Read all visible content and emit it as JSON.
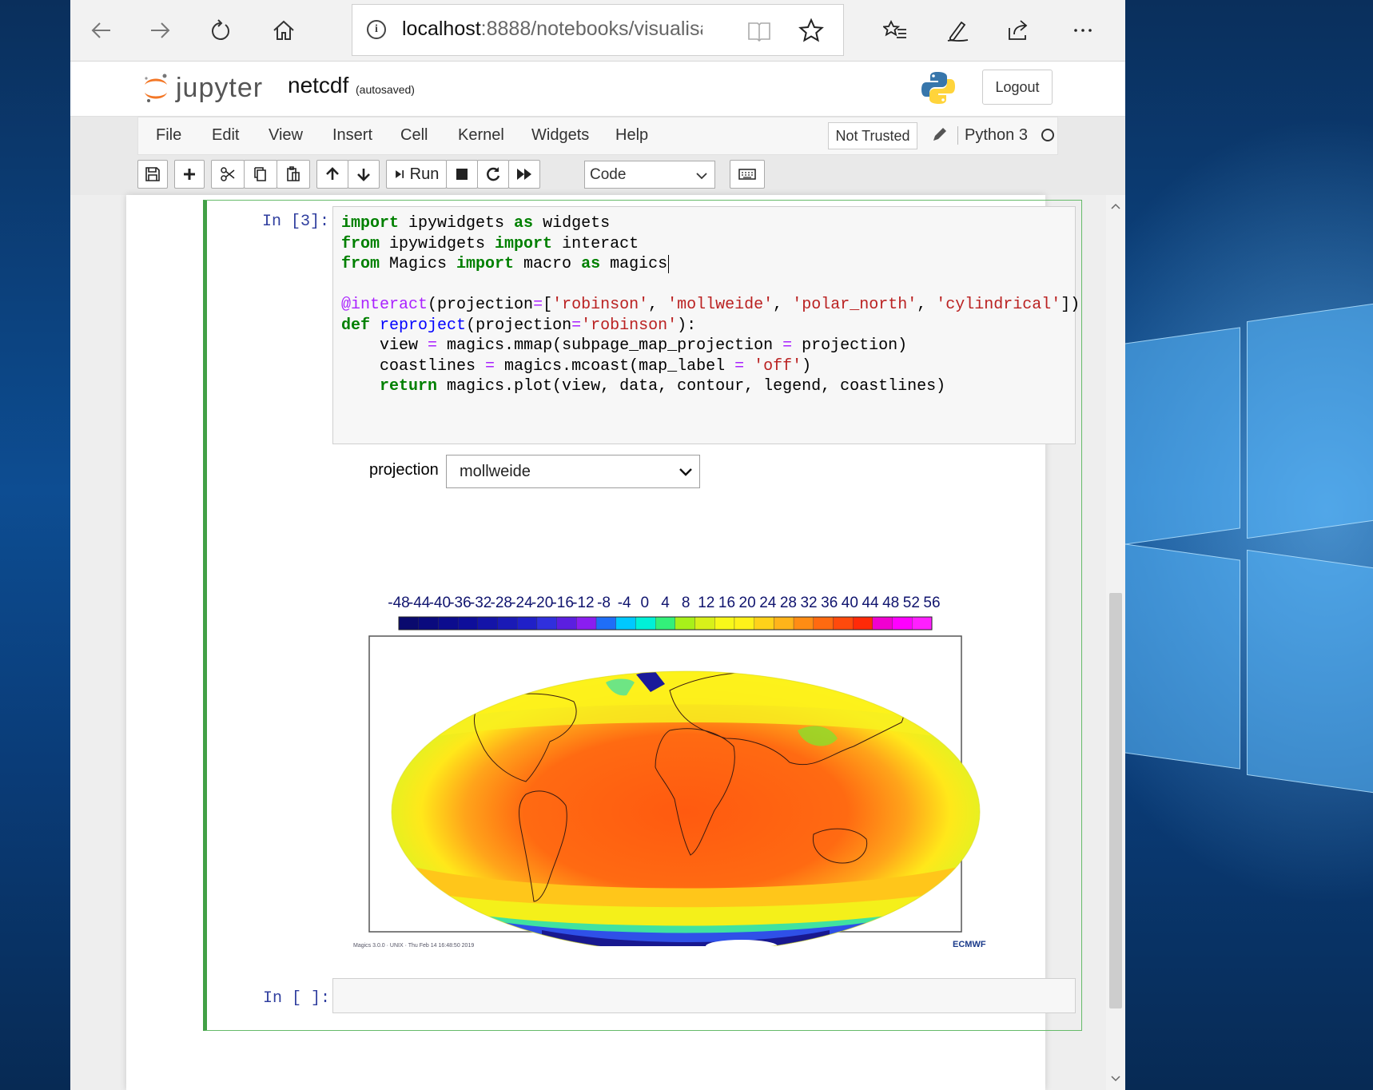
{
  "browser": {
    "url_host": "localhost",
    "url_path": ":8888/notebooks/visualisa"
  },
  "jupyter": {
    "brand": "jupyter",
    "notebook_name": "netcdf",
    "save_status": "(autosaved)",
    "logout_label": "Logout",
    "trust_label": "Not Trusted",
    "kernel_name": "Python 3"
  },
  "menu": {
    "items": [
      "File",
      "Edit",
      "View",
      "Insert",
      "Cell",
      "Kernel",
      "Widgets",
      "Help"
    ]
  },
  "toolbar": {
    "run_label": "Run",
    "cell_type": "Code"
  },
  "cell": {
    "prompt": "In [3]:",
    "code_lines": [
      "import ipywidgets as widgets",
      "from ipywidgets import interact",
      "from Magics import macro as magics",
      "",
      "@interact(projection=['robinson', 'mollweide', 'polar_north', 'cylindrical'])",
      "def reproject(projection='robinson'):",
      "    view = magics.mmap(subpage_map_projection = projection)",
      "    coastlines = magics.mcoast(map_label = 'off')",
      "    return magics.plot(view, data, contour, legend, coastlines)"
    ],
    "widget_label": "projection",
    "widget_value": "mollweide"
  },
  "plot": {
    "colorbar_labels": [
      "-48",
      "-44",
      "-40",
      "-36",
      "-32",
      "-28",
      "-24",
      "-20",
      "-16",
      "-12",
      "-8",
      "-4",
      "0",
      "4",
      "8",
      "12",
      "16",
      "20",
      "24",
      "28",
      "32",
      "36",
      "40",
      "44",
      "48",
      "52",
      "56"
    ],
    "colorbar_colors": [
      "#0a0a6e",
      "#0a0a7e",
      "#0c0c8e",
      "#0e0e9a",
      "#1414a8",
      "#1a1ab6",
      "#2020c8",
      "#3030dd",
      "#5b1fe0",
      "#8a1ef0",
      "#1f6ef7",
      "#00c8ff",
      "#00f0d8",
      "#33f07a",
      "#a8f01a",
      "#d8f01a",
      "#f8f81a",
      "#fff21a",
      "#ffd21a",
      "#ffb41a",
      "#ff8c14",
      "#ff6a10",
      "#ff4a0c",
      "#ff2a08",
      "#f000d0",
      "#ff00ff",
      "#ff20ff"
    ],
    "footer_text": "Magics 3.0.0 · UNIX · Thu Feb 14 16:48:50 2019",
    "credit": "ECMWF"
  },
  "next_cell": {
    "prompt": "In [ ]:"
  }
}
